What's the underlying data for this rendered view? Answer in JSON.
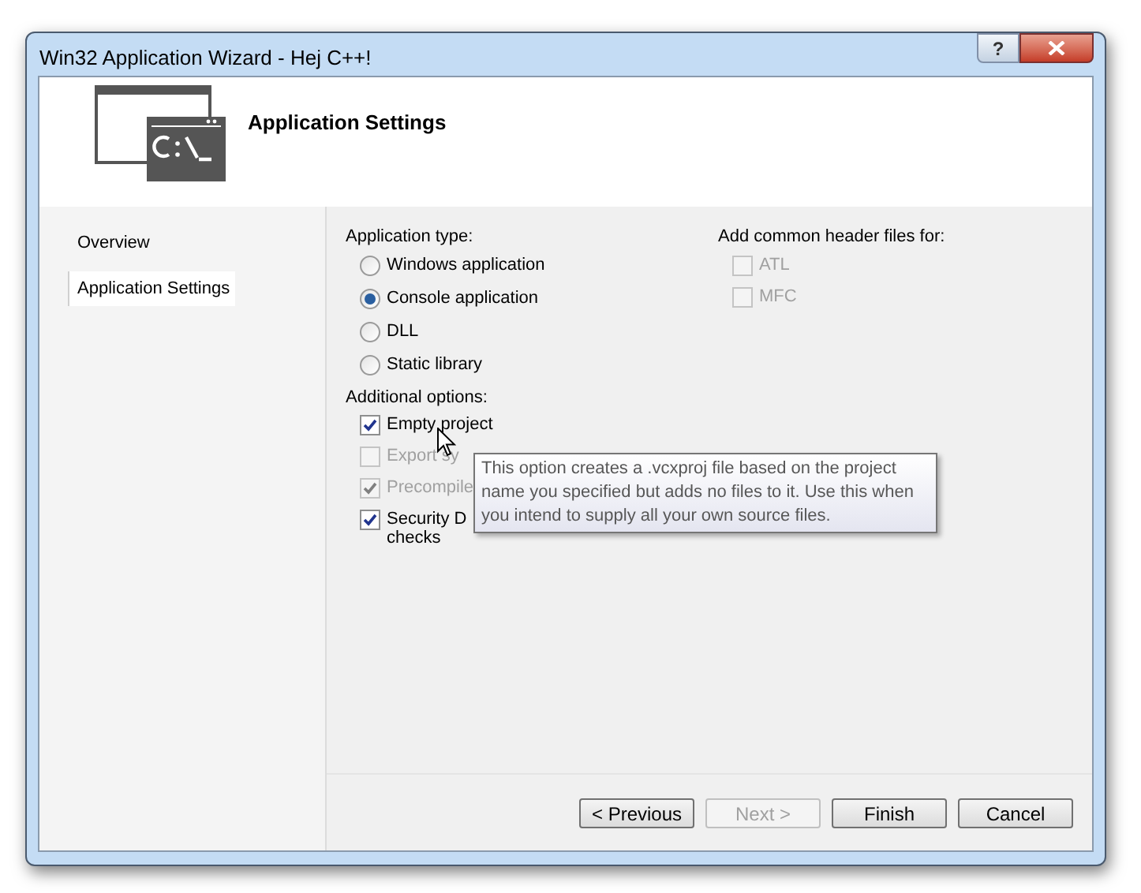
{
  "window": {
    "title": "Win32 Application Wizard - Hej C++!",
    "help_button": "?"
  },
  "header": {
    "title": "Application Settings"
  },
  "sidebar": {
    "items": [
      {
        "label": "Overview",
        "selected": false
      },
      {
        "label": "Application Settings",
        "selected": true
      }
    ]
  },
  "application_type": {
    "label": "Application type:",
    "options": [
      {
        "label": "Windows application",
        "selected": false
      },
      {
        "label": "Console application",
        "selected": true
      },
      {
        "label": "DLL",
        "selected": false
      },
      {
        "label": "Static library",
        "selected": false
      }
    ]
  },
  "additional_options": {
    "label": "Additional options:",
    "options": [
      {
        "label": "Empty project",
        "checked": true,
        "disabled": false
      },
      {
        "label": "Export sy",
        "checked": false,
        "disabled": true
      },
      {
        "label": "Precompile",
        "checked": true,
        "disabled": true
      },
      {
        "label": "Security D\nchecks",
        "checked": true,
        "disabled": false
      }
    ]
  },
  "header_files": {
    "label": "Add common header files for:",
    "options": [
      {
        "label": "ATL",
        "checked": false,
        "disabled": true
      },
      {
        "label": "MFC",
        "checked": false,
        "disabled": true
      }
    ]
  },
  "tooltip": {
    "text": "This option creates a .vcxproj file based on the project name you specified but adds no files to it. Use this when you intend to supply all your own source files."
  },
  "buttons": [
    {
      "label": "< Previous",
      "disabled": false
    },
    {
      "label": "Next >",
      "disabled": true
    },
    {
      "label": "Finish",
      "disabled": false
    },
    {
      "label": "Cancel",
      "disabled": false
    }
  ]
}
